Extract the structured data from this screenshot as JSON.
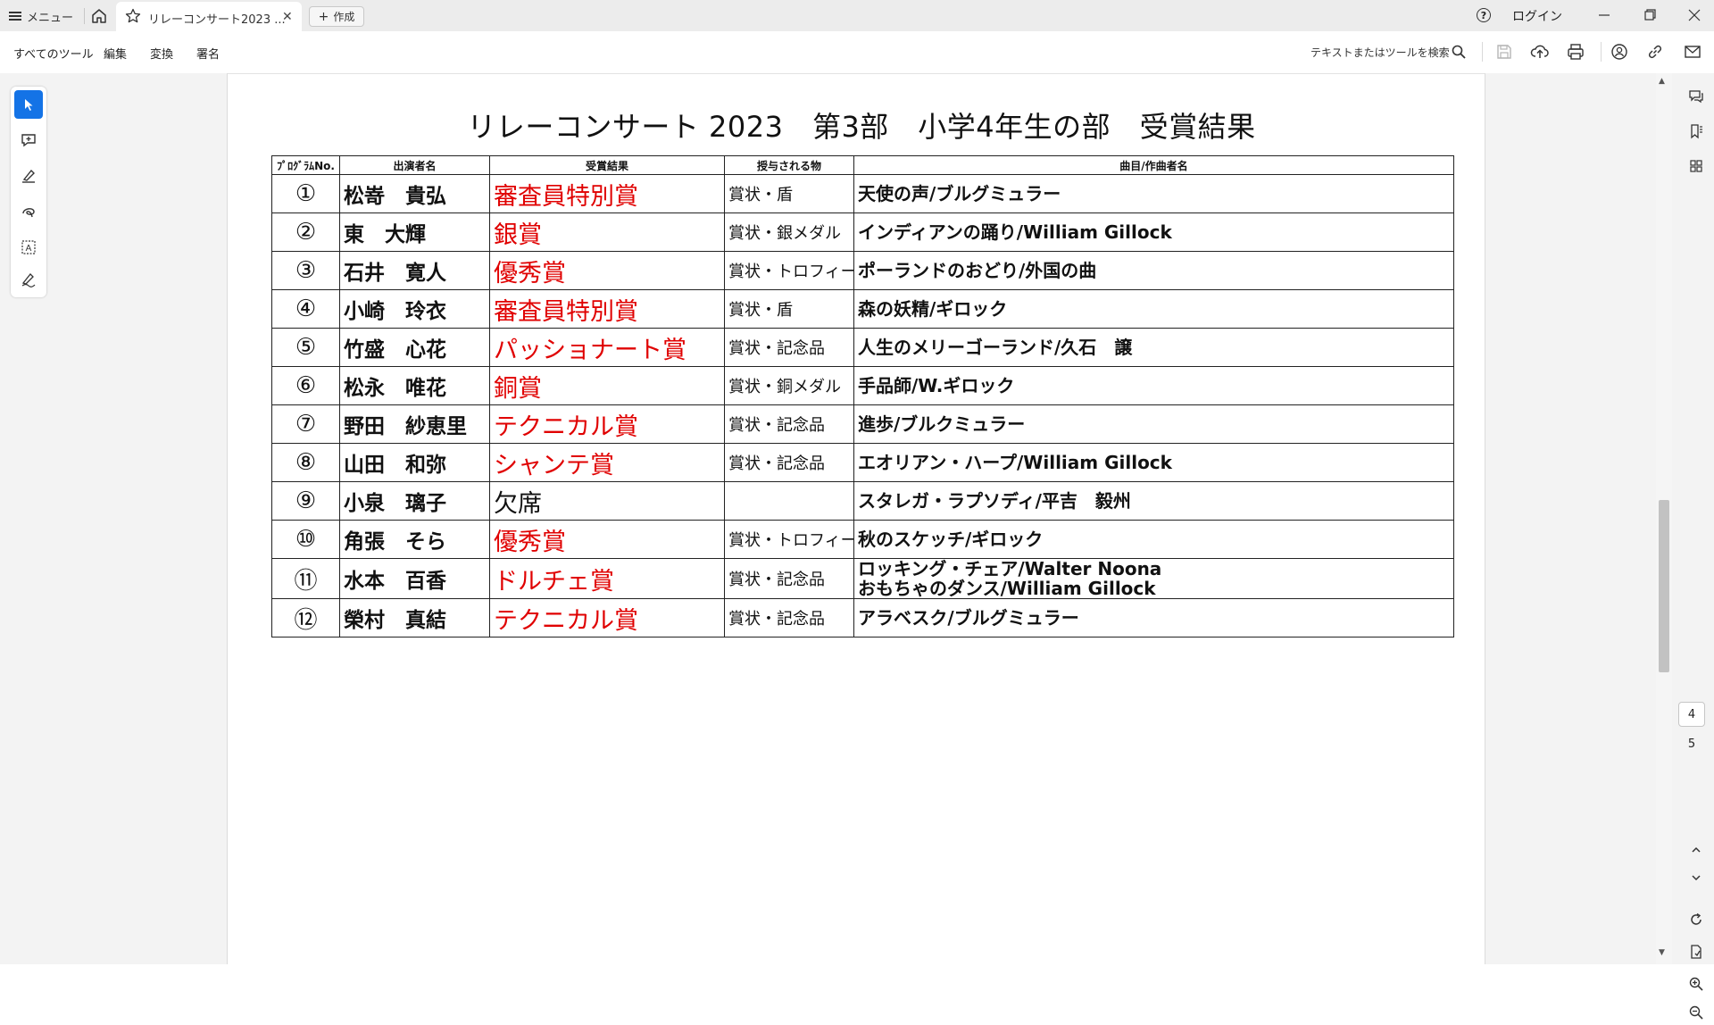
{
  "tabbar": {
    "menu_label": "メニュー",
    "tab_title": "リレーコンサート2023 ...",
    "create_label": "作成",
    "login_label": "ログイン"
  },
  "toolbar": {
    "all_tools": "すべてのツール",
    "edit": "編集",
    "convert": "変換",
    "sign": "署名",
    "search_placeholder": "テキストまたはツールを検索"
  },
  "navigation": {
    "current_page": "4",
    "next_page": "5"
  },
  "document": {
    "title": "リレーコンサート 2023　第3部　小学4年生の部　受賞結果",
    "headers": [
      "ﾌﾟﾛｸﾞﾗﾑNo.",
      "出演者名",
      "受賞結果",
      "授与される物",
      "曲目/作曲者名"
    ],
    "rows": [
      {
        "no": "①",
        "name": "松嵜　貴弘",
        "award": "審査員特別賞",
        "prize": "賞状・盾",
        "pieces": [
          "天使の声/ブルグミュラー"
        ],
        "absent": false
      },
      {
        "no": "②",
        "name": "東　大輝",
        "award": "銀賞",
        "prize": "賞状・銀メダル",
        "pieces": [
          "インディアンの踊り/William Gillock"
        ],
        "absent": false
      },
      {
        "no": "③",
        "name": "石井　寛人",
        "award": "優秀賞",
        "prize": "賞状・トロフィー",
        "pieces": [
          "ポーランドのおどり/外国の曲"
        ],
        "absent": false
      },
      {
        "no": "④",
        "name": "小崎　玲衣",
        "award": "審査員特別賞",
        "prize": "賞状・盾",
        "pieces": [
          "森の妖精/ギロック"
        ],
        "absent": false
      },
      {
        "no": "⑤",
        "name": "竹盛　心花",
        "award": "パッショナート賞",
        "prize": "賞状・記念品",
        "pieces": [
          "人生のメリーゴーランド/久石　譲"
        ],
        "absent": false
      },
      {
        "no": "⑥",
        "name": "松永　唯花",
        "award": "銅賞",
        "prize": "賞状・銅メダル",
        "pieces": [
          "手品師/W.ギロック"
        ],
        "absent": false
      },
      {
        "no": "⑦",
        "name": "野田　紗恵里",
        "award": "テクニカル賞",
        "prize": "賞状・記念品",
        "pieces": [
          "進歩/ブルクミュラー"
        ],
        "absent": false
      },
      {
        "no": "⑧",
        "name": "山田　和弥",
        "award": "シャンテ賞",
        "prize": "賞状・記念品",
        "pieces": [
          "エオリアン・ハープ/William Gillock"
        ],
        "absent": false
      },
      {
        "no": "⑨",
        "name": "小泉　璃子",
        "award": "欠席",
        "prize": "",
        "pieces": [
          "スタレガ・ラプソディ/平吉　毅州"
        ],
        "absent": true
      },
      {
        "no": "⑩",
        "name": "角張　そら",
        "award": "優秀賞",
        "prize": "賞状・トロフィー",
        "pieces": [
          "秋のスケッチ/ギロック"
        ],
        "absent": false
      },
      {
        "no": "⑪",
        "name": "水本　百香",
        "award": "ドルチェ賞",
        "prize": "賞状・記念品",
        "pieces": [
          "ロッキング・チェア/Walter Noona",
          "おもちゃのダンス/William Gillock"
        ],
        "absent": false
      },
      {
        "no": "⑫",
        "name": "榮村　真結",
        "award": "テクニカル賞",
        "prize": "賞状・記念品",
        "pieces": [
          "アラベスク/ブルグミュラー"
        ],
        "absent": false
      }
    ]
  },
  "colors": {
    "award_red": "#e00000",
    "active_tool": "#1473e6"
  }
}
